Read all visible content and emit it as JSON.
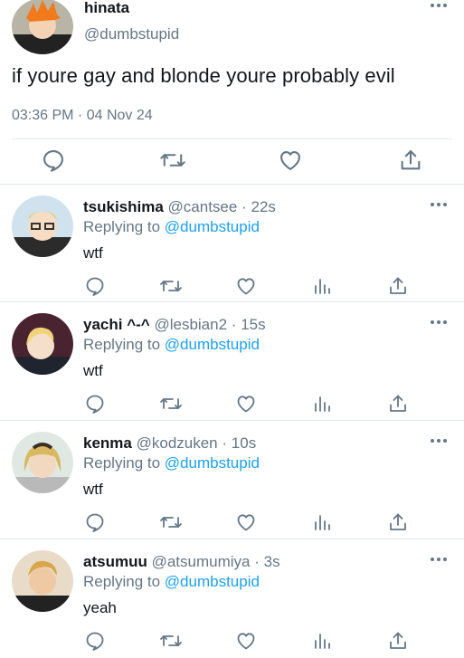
{
  "main_tweet": {
    "name": "hinata",
    "handle": "@dumbstupid",
    "text": "if youre gay and blonde youre probably evil",
    "timestamp": "03:36 PM · 04 Nov 24",
    "actions": [
      "reply-icon",
      "retweet-icon",
      "like-icon",
      "share-icon"
    ]
  },
  "replies": [
    {
      "name": "tsukishima",
      "handle": "@cantsee",
      "time": "22s",
      "replying_label": "Replying to",
      "replying_to": "@dumbstupid",
      "text": "wtf"
    },
    {
      "name": "yachi ^-^",
      "handle": "@lesbian2",
      "time": "15s",
      "replying_label": "Replying to",
      "replying_to": "@dumbstupid",
      "text": "wtf"
    },
    {
      "name": "kenma",
      "handle": "@kodzuken",
      "time": "10s",
      "replying_label": "Replying to",
      "replying_to": "@dumbstupid",
      "text": "wtf"
    },
    {
      "name": "atsumuu",
      "handle": "@atsumumiya",
      "time": "3s",
      "replying_label": "Replying to",
      "replying_to": "@dumbstupid",
      "text": "yeah"
    }
  ],
  "separator": "·",
  "colors": {
    "accent": "#1da1f2",
    "secondary_text": "#657786",
    "divider": "#e1e8ed"
  }
}
